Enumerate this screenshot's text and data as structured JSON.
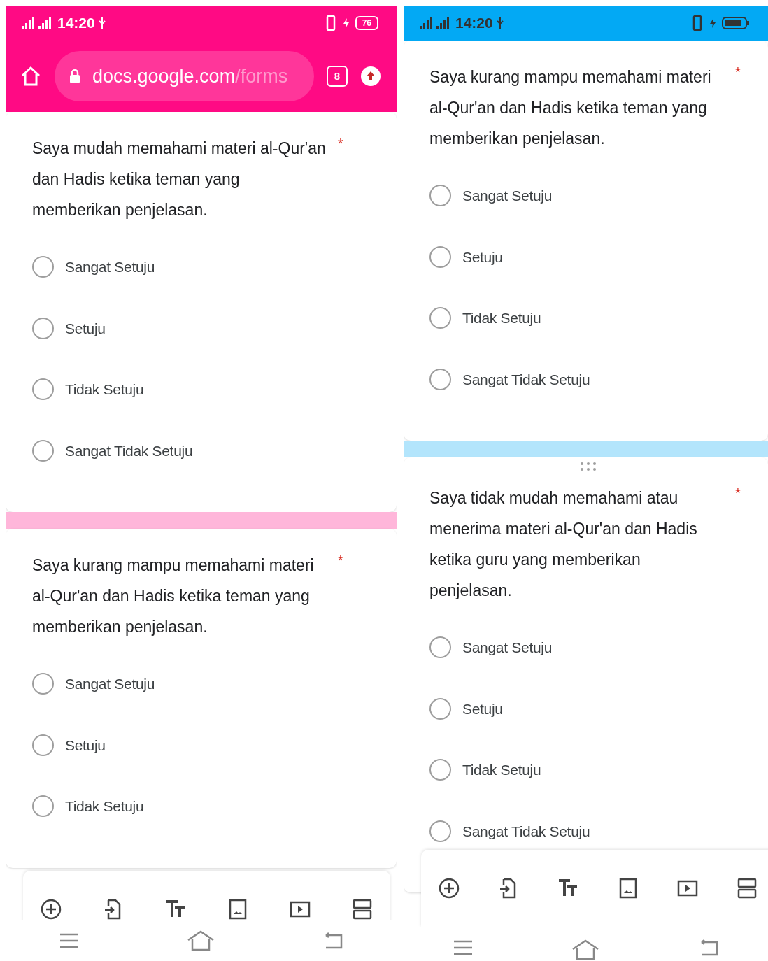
{
  "phones": [
    {
      "color": "#ff0a84",
      "status_bar": {
        "time": "14:20",
        "battery": "76"
      },
      "browser": {
        "url_host": "docs.google.com",
        "url_path": "/forms",
        "tab_count": "8"
      },
      "questions": [
        {
          "text": "Saya mudah memahami materi al-Qur'an dan Hadis ketika teman yang memberikan penjelasan.",
          "required_mark": "*",
          "drag_handle": false,
          "options": [
            {
              "label": "Sangat Setuju",
              "selected": false
            },
            {
              "label": "Setuju",
              "selected": false
            },
            {
              "label": "Tidak Setuju",
              "selected": false
            },
            {
              "label": "Sangat Tidak Setuju",
              "selected": false
            }
          ]
        },
        {
          "text": "Saya kurang mampu memahami materi al-Qur'an dan Hadis ketika teman yang memberikan penjelasan.",
          "required_mark": "*",
          "drag_handle": false,
          "options": [
            {
              "label": "Sangat Setuju",
              "selected": false
            },
            {
              "label": "Setuju",
              "selected": false
            },
            {
              "label": "Tidak Setuju",
              "selected": false
            }
          ]
        }
      ]
    },
    {
      "color": "#03a9f4",
      "status_bar": {
        "time": "14:20"
      },
      "questions": [
        {
          "text": "Saya kurang mampu memahami materi al-Qur'an dan Hadis ketika teman yang memberikan penjelasan.",
          "required_mark": "*",
          "drag_handle": false,
          "options": [
            {
              "label": "Sangat Setuju",
              "selected": false
            },
            {
              "label": "Setuju",
              "selected": false
            },
            {
              "label": "Tidak Setuju",
              "selected": false
            },
            {
              "label": "Sangat Tidak Setuju",
              "selected": false
            }
          ]
        },
        {
          "text": "Saya tidak mudah memahami atau menerima materi al-Qur'an dan Hadis ketika guru yang memberikan penjelasan.",
          "required_mark": "*",
          "drag_handle": true,
          "options": [
            {
              "label": "Sangat Setuju",
              "selected": false
            },
            {
              "label": "Setuju",
              "selected": false
            },
            {
              "label": "Tidak Setuju",
              "selected": false
            },
            {
              "label": "Sangat Tidak Setuju",
              "selected": false
            }
          ]
        }
      ]
    }
  ]
}
